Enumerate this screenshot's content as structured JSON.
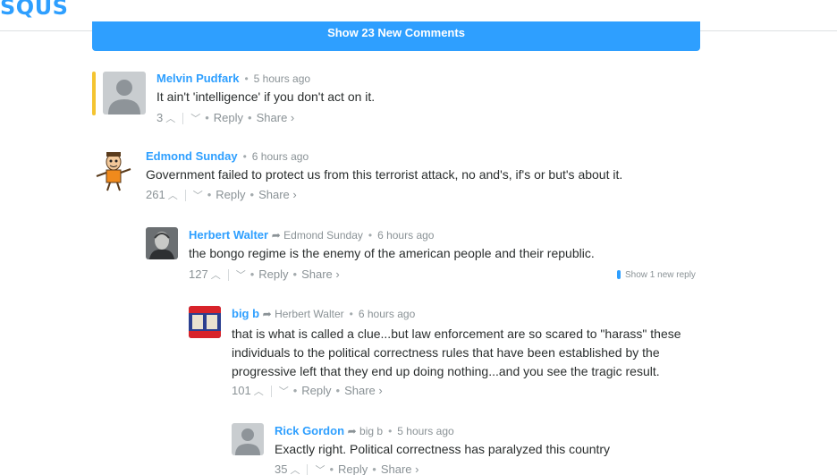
{
  "app": {
    "logo_text": "SQUS",
    "brand_color": "#2e9fff"
  },
  "banner": {
    "label": "Show 23 New Comments"
  },
  "comments": [
    {
      "author": "Melvin Pudfark",
      "parent": "",
      "time": "5 hours ago",
      "text": "It ain't 'intelligence' if you don't act on it.",
      "votes": "3",
      "reply_label": "Reply",
      "share_label": "Share ›",
      "avatar": "default-avatar",
      "highlighted": true
    },
    {
      "author": "Edmond Sunday",
      "parent": "",
      "time": "6 hours ago",
      "text": "Government failed to protect us from this terrorist attack, no and's, if's or but's about it.",
      "votes": "261",
      "reply_label": "Reply",
      "share_label": "Share ›",
      "avatar": "cartoon-avatar"
    },
    {
      "author": "Herbert Walter",
      "parent": "Edmond Sunday",
      "time": "6 hours ago",
      "text": "the bongo regime is the enemy of the american people and their republic.",
      "votes": "127",
      "reply_label": "Reply",
      "share_label": "Share ›",
      "new_replies": "Show 1 new reply",
      "avatar": "portrait-avatar"
    },
    {
      "author": "big b",
      "parent": "Herbert Walter",
      "time": "6 hours ago",
      "text": "that is what is called a clue...but law enforcement are so scared to \"harass\" these individuals to the political correctness rules that have been established by the progressive left that they end up doing nothing...and you see the tragic result.",
      "votes": "101",
      "reply_label": "Reply",
      "share_label": "Share ›",
      "avatar": "poster-avatar"
    },
    {
      "author": "Rick Gordon",
      "parent": "big b",
      "time": "5 hours ago",
      "text": "Exactly right. Political correctness has paralyzed this country",
      "votes": "35",
      "reply_label": "Reply",
      "share_label": "Share ›",
      "avatar": "default-avatar"
    }
  ],
  "icons": {
    "upvote": "▲",
    "downvote": "∨",
    "reply_arrow": "➦"
  }
}
